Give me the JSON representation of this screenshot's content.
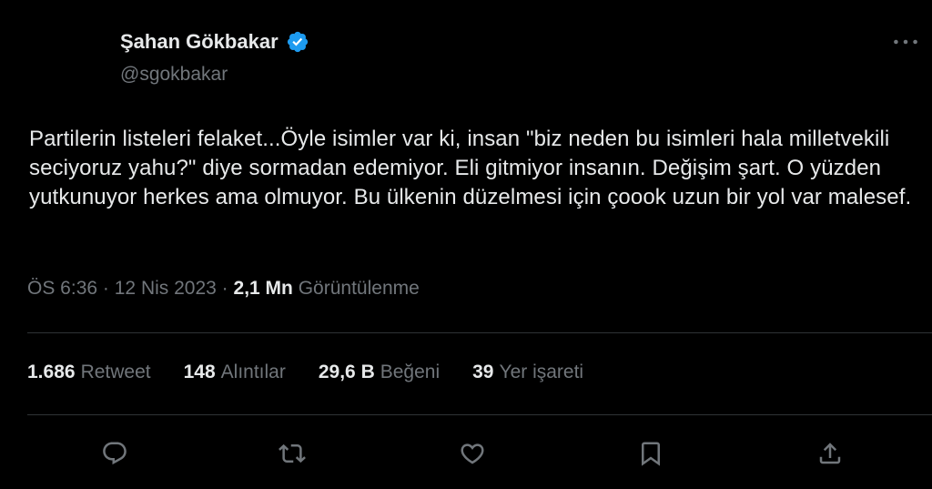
{
  "author": {
    "name": "Şahan Gökbakar",
    "handle": "@sgokbakar",
    "verified_icon": "verified-badge-icon"
  },
  "tweet": {
    "text": "Partilerin listeleri felaket...Öyle isimler var ki, insan \"biz neden bu isimleri hala milletvekili seciyoruz yahu?\" diye sormadan edemiyor. Eli gitmiyor insanın. Değişim şart. O yüzden yutkunuyor herkes ama olmuyor. Bu ülkenin düzelmesi için çoook uzun bir yol var malesef.",
    "time": "ÖS 6:36",
    "separator": "·",
    "date": "12 Nis 2023",
    "views_count": "2,1 Mn",
    "views_label": "Görüntülenme"
  },
  "stats": [
    {
      "count": "1.686",
      "label": "Retweet"
    },
    {
      "count": "148",
      "label": "Alıntılar"
    },
    {
      "count": "29,6 B",
      "label": "Beğeni"
    },
    {
      "count": "39",
      "label": "Yer işareti"
    }
  ],
  "actions": [
    "reply-icon",
    "retweet-icon",
    "like-icon",
    "bookmark-icon",
    "share-icon"
  ],
  "colors": {
    "background": "#000000",
    "text_primary": "#e7e9ea",
    "text_secondary": "#71767b",
    "divider": "#2f3336",
    "verified": "#1d9bf0"
  }
}
